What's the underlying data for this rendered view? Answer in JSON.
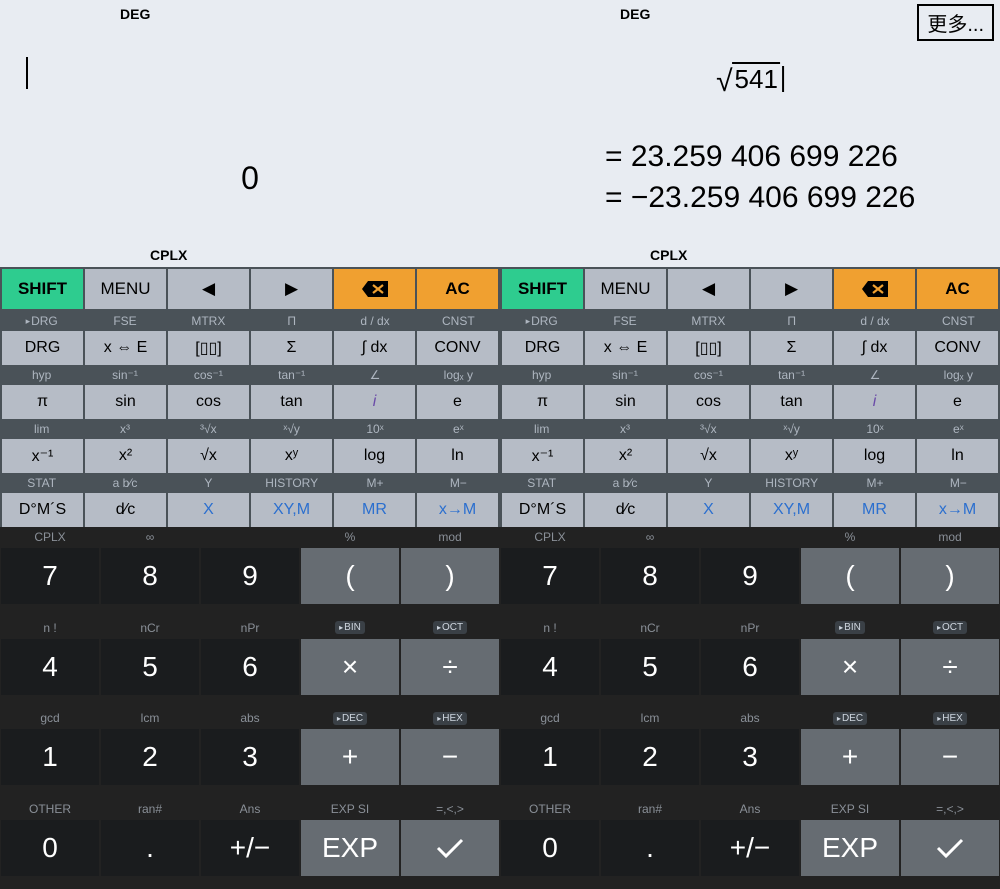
{
  "more_button": "更多...",
  "left": {
    "status_top": "DEG",
    "status_bot": "CPLX",
    "expression": "",
    "result": "0"
  },
  "right": {
    "status_top": "DEG",
    "status_bot": "CPLX",
    "expression_root": "541",
    "result_line1": "= 23.259 406 699 226",
    "result_line2": "= −23.259 406 699 226"
  },
  "toprow": {
    "shift": "SHIFT",
    "menu": "MENU",
    "left_arrow": "◀",
    "right_arrow": "▶",
    "ac": "AC"
  },
  "sec1": [
    "DRG",
    "FSE",
    "MTRX",
    "Π",
    "d / dx",
    "CNST"
  ],
  "fn1": [
    "DRG",
    "x ⇔ E",
    "[▯▯]",
    "Σ",
    "∫ dx",
    "CONV"
  ],
  "sec2": [
    "hyp",
    "sin⁻¹",
    "cos⁻¹",
    "tan⁻¹",
    "∠",
    "logₓ y"
  ],
  "fn2": [
    "π",
    "sin",
    "cos",
    "tan",
    "i",
    "e"
  ],
  "sec3": [
    "lim",
    "x³",
    "³√x",
    "ˣ√y",
    "10ˣ",
    "eˣ"
  ],
  "fn3": [
    "x⁻¹",
    "x²",
    "√x",
    "xʸ",
    "log",
    "ln"
  ],
  "sec4": [
    "STAT",
    "a b⁄c",
    "Y",
    "HISTORY",
    "M+",
    "M−"
  ],
  "fn4": [
    "D°M´S",
    "d⁄c",
    "X",
    "XY,M",
    "MR",
    "x→M"
  ],
  "nsec": [
    [
      "CPLX",
      "∞",
      "",
      "%",
      "mod"
    ],
    [
      "n !",
      "nCr",
      "nPr",
      "BIN",
      "OCT"
    ],
    [
      "gcd",
      "lcm",
      "abs",
      "DEC",
      "HEX"
    ],
    [
      "OTHER",
      "ran#",
      "Ans",
      "EXP SI",
      "=,<,>"
    ]
  ],
  "nums": [
    [
      "7",
      "8",
      "9",
      "(",
      ")"
    ],
    [
      "4",
      "5",
      "6",
      "×",
      "÷"
    ],
    [
      "1",
      "2",
      "3",
      "+",
      "−"
    ],
    [
      "0",
      ".",
      "+/−",
      "EXP",
      "✓"
    ]
  ]
}
